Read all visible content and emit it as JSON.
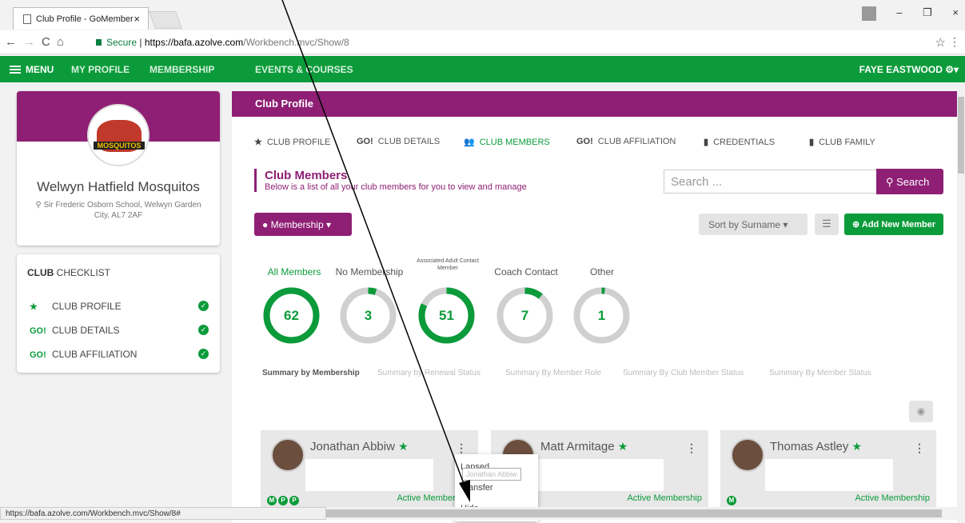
{
  "browser": {
    "tab_title": "Club Profile - GoMember",
    "url_secure": "Secure",
    "url_domain": "https://bafa.azolve.com",
    "url_path": "/Workbench.mvc/Show/8",
    "status_url": "https://bafa.azolve.com/Workbench.mvc/Show/8#"
  },
  "topnav": {
    "menu": "MENU",
    "items": [
      "MY PROFILE",
      "MEMBERSHIP",
      "EVENTS & COURSES"
    ],
    "user": "FAYE EASTWOOD"
  },
  "club": {
    "logo_text": "MOSQUITOS",
    "name": "Welwyn Hatfield Mosquitos",
    "address": "Sir Frederic Osborn School, Welwyn Garden City, AL7 2AF"
  },
  "checklist": {
    "title_bold": "CLUB",
    "title_rest": " CHECKLIST",
    "items": [
      {
        "icon": "★",
        "label": "CLUB PROFILE"
      },
      {
        "icon": "GO!",
        "label": "CLUB DETAILS"
      },
      {
        "icon": "GO!",
        "label": "CLUB AFFILIATION"
      }
    ]
  },
  "main": {
    "header": "Club Profile",
    "tabs": [
      {
        "icon": "★",
        "label": "CLUB PROFILE"
      },
      {
        "icon": "GO!",
        "label": "CLUB DETAILS"
      },
      {
        "icon": "👥",
        "label": "CLUB MEMBERS"
      },
      {
        "icon": "GO!",
        "label": "CLUB AFFILIATION"
      },
      {
        "icon": "▮",
        "label": "CREDENTIALS"
      },
      {
        "icon": "▮",
        "label": "CLUB FAMILY"
      }
    ],
    "section_title": "Club Members",
    "section_desc": "Below is a list of all your club members for you to view and manage",
    "search_placeholder": "Search ...",
    "search_button": "Search",
    "membership_button": "Membership",
    "sort_button": "Sort by Surname",
    "add_button": "Add New Member"
  },
  "summary": {
    "categories": [
      {
        "label": "All Members",
        "value": "62",
        "fraction": 1.0
      },
      {
        "label": "No Membership",
        "value": "3",
        "fraction": 0.05
      },
      {
        "label": "Associated Adult Contact Member",
        "value": "51",
        "fraction": 0.82
      },
      {
        "label": "Coach Contact",
        "value": "7",
        "fraction": 0.11
      },
      {
        "label": "Other",
        "value": "1",
        "fraction": 0.02
      }
    ],
    "links": [
      "Summary by Membership",
      "Summary by Renewal Status",
      "Summary By Member Role",
      "Summary By Club Member Status",
      "Summary By Member Status"
    ]
  },
  "members": [
    {
      "name": "Jonathan Abbiw",
      "status": "Active Membership",
      "badges": [
        "M",
        "P",
        "P"
      ]
    },
    {
      "name": "Matt Armitage",
      "status": "Active Membership",
      "badges": []
    },
    {
      "name": "Thomas Astley",
      "status": "Active Membership",
      "badges": [
        "M"
      ]
    }
  ],
  "dropdown": {
    "items": [
      "Lapsed",
      "Transfer",
      "Hide"
    ],
    "tooltip": "Jonathan Abbiw"
  },
  "colors": {
    "brand_purple": "#8e1f74",
    "brand_green": "#0c9b3a"
  }
}
